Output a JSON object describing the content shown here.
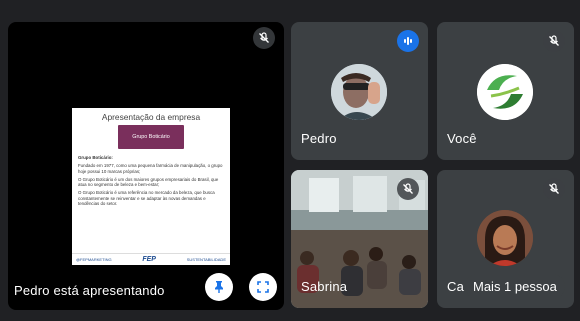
{
  "main": {
    "presenter_label": "Pedro está apresentando",
    "slide": {
      "title": "Apresentação da empresa",
      "logo_text": "Grupo Boticário",
      "paragraphs": [
        "Grupo Boticário:",
        "Fundado em 1977, como uma pequena farmácia de manipulação, o grupo hoje possui 10 marcas próprias;",
        "O Grupo Boticário é um dos maiores grupos empresariais do Brasil, que atua no segmento de beleza e bem-estar;",
        "O Grupo Boticário é uma referência no mercado da beleza, que busca constantemente se reinventar e se adaptar às novas demandas e tendências do setor."
      ],
      "footer_left": "@FEPMARKETING",
      "footer_center": "FEP",
      "footer_right": "SUSTENTABILIDADE"
    }
  },
  "participants": {
    "pedro": {
      "name": "Pedro"
    },
    "voce": {
      "name": "Você"
    },
    "sabrina": {
      "name": "Sabrina"
    },
    "last": {
      "name": "Ca",
      "more_label": "Mais 1 pessoa"
    }
  },
  "colors": {
    "background": "#202124",
    "tile": "#3c4043",
    "speaking": "#1a73e8",
    "slide_logo": "#7a2f5c"
  }
}
